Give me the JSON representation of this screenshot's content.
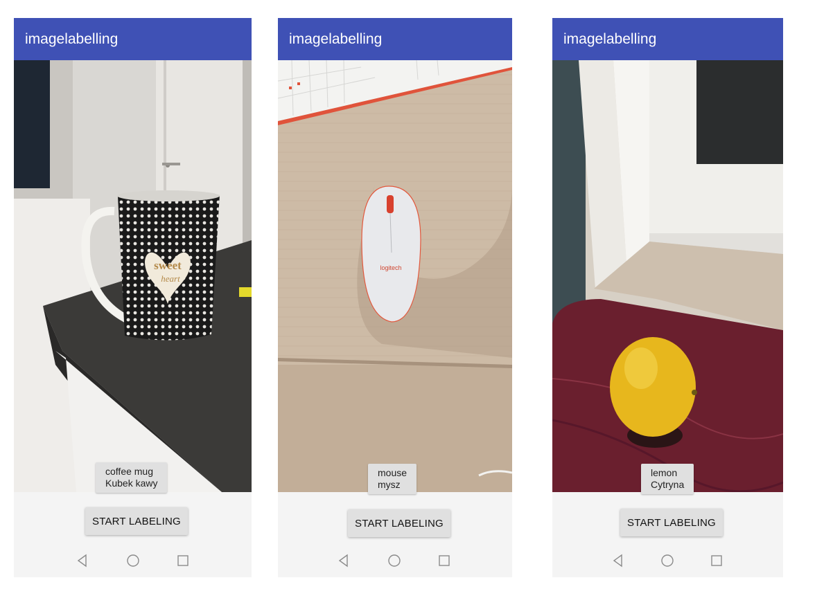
{
  "screens": [
    {
      "app_title": "imagelabelling",
      "photo_subject": "coffee mug",
      "label_lines": [
        "coffee mug",
        "Kubek kawy"
      ],
      "button_label": "START LABELING"
    },
    {
      "app_title": "imagelabelling",
      "photo_subject": "mouse",
      "label_lines": [
        "mouse",
        "mysz"
      ],
      "button_label": "START LABELING"
    },
    {
      "app_title": "imagelabelling",
      "photo_subject": "lemon",
      "label_lines": [
        "lemon",
        "Cytryna"
      ],
      "button_label": "START LABELING"
    }
  ],
  "navigation_icons": [
    "back-icon",
    "home-icon",
    "recents-icon"
  ],
  "colors": {
    "appbar": "#3f51b5",
    "button": "#e0e0e0",
    "background": "#f4f4f4"
  }
}
